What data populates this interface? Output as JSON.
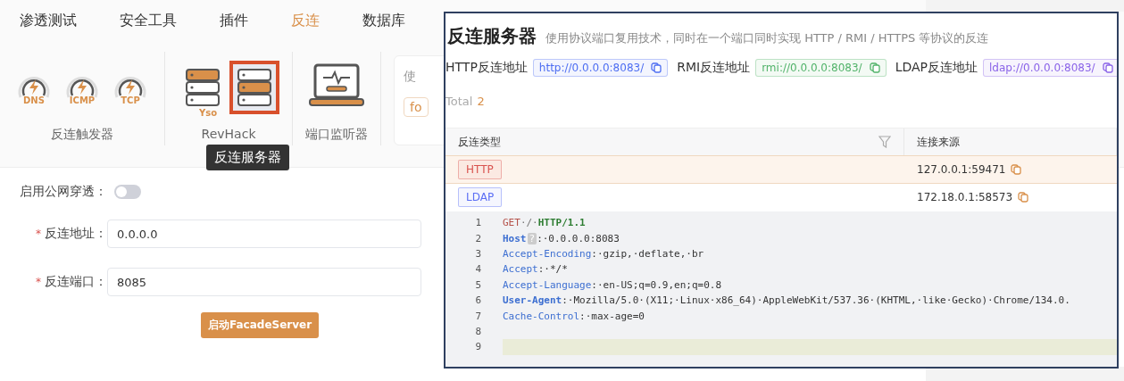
{
  "tabs": [
    {
      "label": "渗透测试",
      "selected": false
    },
    {
      "label": "安全工具",
      "selected": false
    },
    {
      "label": "插件",
      "selected": false
    },
    {
      "label": "反连",
      "selected": true
    },
    {
      "label": "数据库",
      "selected": false
    }
  ],
  "ribbon": {
    "groups": [
      {
        "label": "反连触发器",
        "items": [
          {
            "kind": "gauge",
            "label": "DNS"
          },
          {
            "kind": "gauge",
            "label": "ICMP"
          },
          {
            "kind": "gauge",
            "label": "TCP"
          }
        ]
      },
      {
        "label": "RevHack",
        "items": [
          {
            "kind": "server",
            "label": "Yso",
            "selected": false
          },
          {
            "kind": "server",
            "selected": true
          }
        ]
      },
      {
        "label": "端口监听器",
        "items": [
          {
            "kind": "monitor"
          }
        ]
      }
    ],
    "side_card": {
      "text": "使",
      "tag": "fo"
    }
  },
  "tooltip": "反连服务器",
  "form": {
    "tunnel": {
      "label": "启用公网穿透：",
      "on": false
    },
    "fields": [
      {
        "mark": "*",
        "label": "反连地址：",
        "value": "0.0.0.0"
      },
      {
        "mark": "*",
        "label": "反连端口：",
        "value": "8085"
      }
    ],
    "submit": "启动FacadeServer"
  },
  "server_window": {
    "title": "反连服务器",
    "description": "使用协议端口复用技术，同时在一个端口同时实现 HTTP / RMI / HTTPS 等协议的反连",
    "addresses": [
      {
        "label": "HTTP反连地址",
        "value": "http://0.0.0.0:8083/",
        "color": "#4e6ef2"
      },
      {
        "label": "RMI反连地址",
        "value": "rmi://0.0.0.0:8083/",
        "color": "#52b36a"
      },
      {
        "label": "LDAP反连地址",
        "value": "ldap://0.0.0.0:8083/",
        "color": "#8a63e8"
      }
    ],
    "total_label": "Total",
    "total": "2",
    "table": {
      "columns": [
        "反连类型",
        "连接来源"
      ],
      "rows": [
        {
          "type": "HTTP",
          "color": "#d9534f",
          "source": "127.0.0.1:59471",
          "selected": true
        },
        {
          "type": "LDAP",
          "color": "#5b6ef5",
          "source": "172.18.0.1:58573",
          "selected": false
        }
      ]
    },
    "code": [
      {
        "number": "1",
        "kind": "request",
        "method": "GET",
        "path": "·/·",
        "version": "HTTP/1.1"
      },
      {
        "number": "2",
        "kind": "header",
        "name": "Host",
        "hint": "?",
        "value": ":·0.0.0.0:8083",
        "bold": true
      },
      {
        "number": "3",
        "kind": "header",
        "name": "Accept-Encoding",
        "value": ":·gzip,·deflate,·br",
        "bold": false
      },
      {
        "number": "4",
        "kind": "header",
        "name": "Accept",
        "value": ":·*/*",
        "bold": false
      },
      {
        "number": "5",
        "kind": "header",
        "name": "Accept-Language",
        "value": ":·en-US;q=0.9,en;q=0.8",
        "bold": false
      },
      {
        "number": "6",
        "kind": "header",
        "name": "User-Agent",
        "value": ":·Mozilla/5.0·(X11;·Linux·x86_64)·AppleWebKit/537.36·(KHTML,·like·Gecko)·Chrome/134.0.",
        "bold": true
      },
      {
        "number": "7",
        "kind": "header",
        "name": "Cache-Control",
        "value": ":·max-age=0",
        "bold": false
      },
      {
        "number": "8",
        "kind": "blank",
        "selected": false
      },
      {
        "number": "9",
        "kind": "blank",
        "selected": true
      }
    ]
  }
}
